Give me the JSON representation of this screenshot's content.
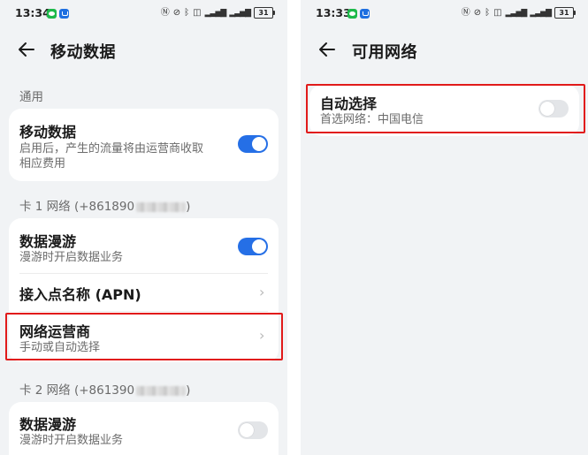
{
  "left": {
    "status": {
      "time": "13:34",
      "battery": "31"
    },
    "title": "移动数据",
    "sections": {
      "general": "通用",
      "card1_prefix": "卡 1 网络 (+861890",
      "card1_suffix": ")",
      "card2_prefix": "卡 2 网络 (+861390",
      "card2_suffix": ")"
    },
    "mobile_data": {
      "title": "移动数据",
      "subtitle_line1": "启用后，产生的流量将由运营商收取",
      "subtitle_line2": "相应费用",
      "enabled": true
    },
    "card1": {
      "roaming_title": "数据漫游",
      "roaming_subtitle": "漫游时开启数据业务",
      "roaming_enabled": true,
      "apn_label": "接入点名称 (APN)",
      "carrier_title": "网络运营商",
      "carrier_subtitle": "手动或自动选择"
    },
    "card2": {
      "roaming_title": "数据漫游",
      "roaming_subtitle": "漫游时开启数据业务",
      "roaming_enabled": false
    }
  },
  "right": {
    "status": {
      "time": "13:33",
      "battery": "31"
    },
    "title": "可用网络",
    "auto_select": {
      "title": "自动选择",
      "subtitle": "首选网络：中国电信",
      "enabled": false
    }
  },
  "colors": {
    "accent": "#256fe6",
    "highlight": "#e11a1a",
    "background": "#f1f3f5"
  }
}
